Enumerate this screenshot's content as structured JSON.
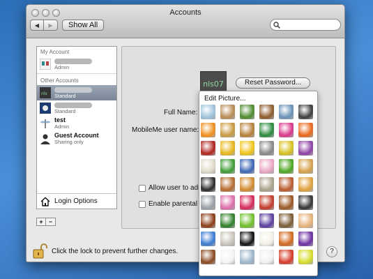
{
  "window": {
    "title": "Accounts"
  },
  "toolbar": {
    "back": "◀",
    "forward": "▶",
    "show_all": "Show All",
    "search_placeholder": ""
  },
  "sidebar": {
    "my_account_header": "My Account",
    "my_account": {
      "name": "",
      "role": "Admin"
    },
    "other_accounts_header": "Other Accounts",
    "accounts": [
      {
        "name": "",
        "role": "Standard",
        "selected": true
      },
      {
        "name": "",
        "role": "Standard",
        "selected": false
      },
      {
        "name": "test",
        "role": "Admin",
        "selected": false
      },
      {
        "name": "Guest Account",
        "role": "Sharing only",
        "selected": false
      }
    ],
    "login_options": "Login Options",
    "add": "+",
    "remove": "−"
  },
  "panel": {
    "reset_password": "Reset Password...",
    "full_name_label": "Full Name:",
    "mobileme_label": "MobileMe user name:",
    "allow_admin": "Allow user to adm",
    "parental": "Enable parental c",
    "user_picture_text": "nls07"
  },
  "bottom": {
    "lock_text": "Click the lock to prevent further changes.",
    "help": "?"
  },
  "picture_menu": {
    "edit_label": "Edit Picture...",
    "pictures": [
      "dragonfly",
      "cat",
      "ladybug",
      "dog",
      "dragonfly-blue",
      "eagle",
      "goldfish",
      "leopard",
      "lion",
      "parrot",
      "flower-pink",
      "gerbera",
      "red-leaf",
      "sunflower",
      "flower-yellow",
      "zebra",
      "daisy-yellow",
      "flower-purple",
      "caduceus",
      "green-abstract",
      "abstract-blue",
      "cupcake",
      "green-leaf",
      "fortune-cookie",
      "gearshift",
      "gingerbread",
      "starfish",
      "zen",
      "painting",
      "pizza",
      "robot",
      "nature-pink",
      "lips",
      "drum",
      "guitar",
      "piano",
      "violin",
      "green-spikes",
      "leaf-green",
      "lightning",
      "nest",
      "seashell",
      "snowflake",
      "sand",
      "8-ball",
      "baseball",
      "basketball",
      "bowling",
      "football",
      "golf",
      "hockey",
      "soccer",
      "target",
      "tennis"
    ]
  }
}
